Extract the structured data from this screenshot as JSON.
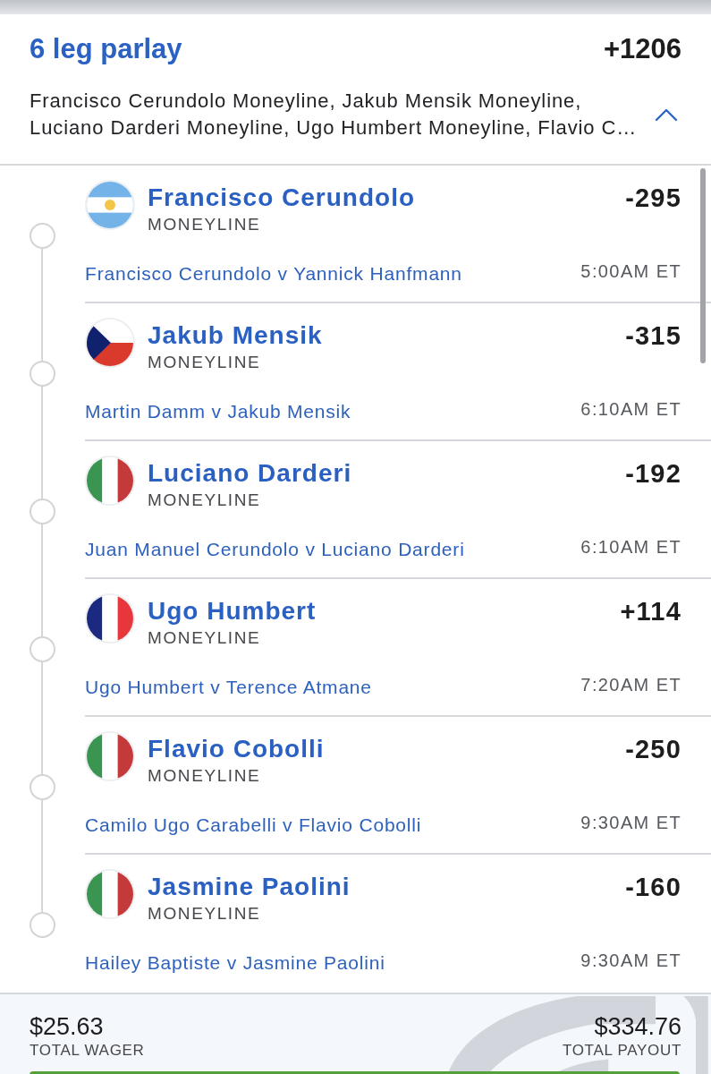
{
  "parlay": {
    "title": "6 leg parlay",
    "odds": "+1206",
    "summary": "Francisco Cerundolo Moneyline, Jakub Mensik Moneyline, Luciano Darderi Moneyline, Ugo Humbert Moneyline, Flavio C…",
    "expanded": true
  },
  "legs": [
    {
      "kind": "argentina",
      "player": "Francisco Cerundolo",
      "market": "MONEYLINE",
      "odds": "-295",
      "matchup": "Francisco Cerundolo v Yannick Hanfmann",
      "time": "5:00AM ET"
    },
    {
      "kind": "czechia",
      "player": "Jakub Mensik",
      "market": "MONEYLINE",
      "odds": "-315",
      "matchup": "Martin Damm v Jakub Mensik",
      "time": "6:10AM ET"
    },
    {
      "kind": "italy",
      "player": "Luciano Darderi",
      "market": "MONEYLINE",
      "odds": "-192",
      "matchup": "Juan Manuel Cerundolo v Luciano Darderi",
      "time": "6:10AM ET"
    },
    {
      "kind": "france",
      "player": "Ugo Humbert",
      "market": "MONEYLINE",
      "odds": "+114",
      "matchup": "Ugo Humbert v Terence Atmane",
      "time": "7:20AM ET"
    },
    {
      "kind": "italy",
      "player": "Flavio Cobolli",
      "market": "MONEYLINE",
      "odds": "-250",
      "matchup": "Camilo Ugo Carabelli v Flavio Cobolli",
      "time": "9:30AM ET"
    },
    {
      "kind": "italy",
      "player": "Jasmine Paolini",
      "market": "MONEYLINE",
      "odds": "-160",
      "matchup": "Hailey Baptiste v Jasmine Paolini",
      "time": "9:30AM ET"
    }
  ],
  "totals": {
    "wager": "$25.63",
    "wager_label": "TOTAL WAGER",
    "payout": "$334.76",
    "payout_label": "TOTAL PAYOUT"
  }
}
